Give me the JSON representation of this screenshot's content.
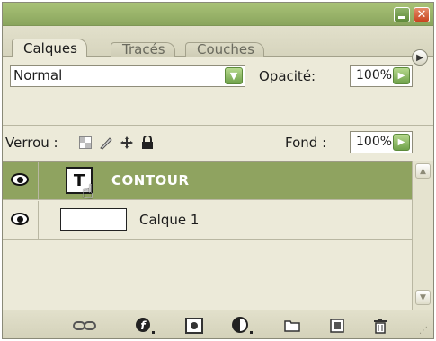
{
  "window": {
    "minimize_icon": "minimize-icon",
    "close_icon": "close-icon",
    "close_glyph": "✕"
  },
  "tabs": [
    {
      "label": "Calques",
      "active": true
    },
    {
      "label": "Tracés",
      "active": false
    },
    {
      "label": "Couches",
      "active": false
    }
  ],
  "panel_menu_icon": "panel-menu-icon",
  "blend": {
    "value": "Normal",
    "icon": "chevron-down-icon"
  },
  "opacity": {
    "label": "Opacité:",
    "value": "100%",
    "icon": "arrow-right-icon"
  },
  "lock": {
    "label": "Verrou :",
    "icons": [
      "lock-transparency-icon",
      "lock-image-icon",
      "lock-position-icon",
      "lock-all-icon"
    ]
  },
  "fill": {
    "label": "Fond :",
    "value": "100%",
    "icon": "arrow-right-icon"
  },
  "layers": [
    {
      "name": "CONTOUR",
      "selected": true,
      "visible": true,
      "kind": "text",
      "thumb_glyph": "T"
    },
    {
      "name": "Calque 1",
      "selected": false,
      "visible": true,
      "kind": "raster"
    }
  ],
  "bottom_icons": [
    "link-layers-icon",
    "layer-style-icon",
    "layer-mask-icon",
    "adjustment-layer-icon",
    "group-folder-icon",
    "new-layer-icon",
    "trash-icon"
  ],
  "colors": {
    "titlebar": "#8aa55d",
    "selected_layer": "#8fa360",
    "panel_bg": "#ecead9",
    "accent_button": "#6fa14a",
    "close_button": "#c8441f"
  }
}
